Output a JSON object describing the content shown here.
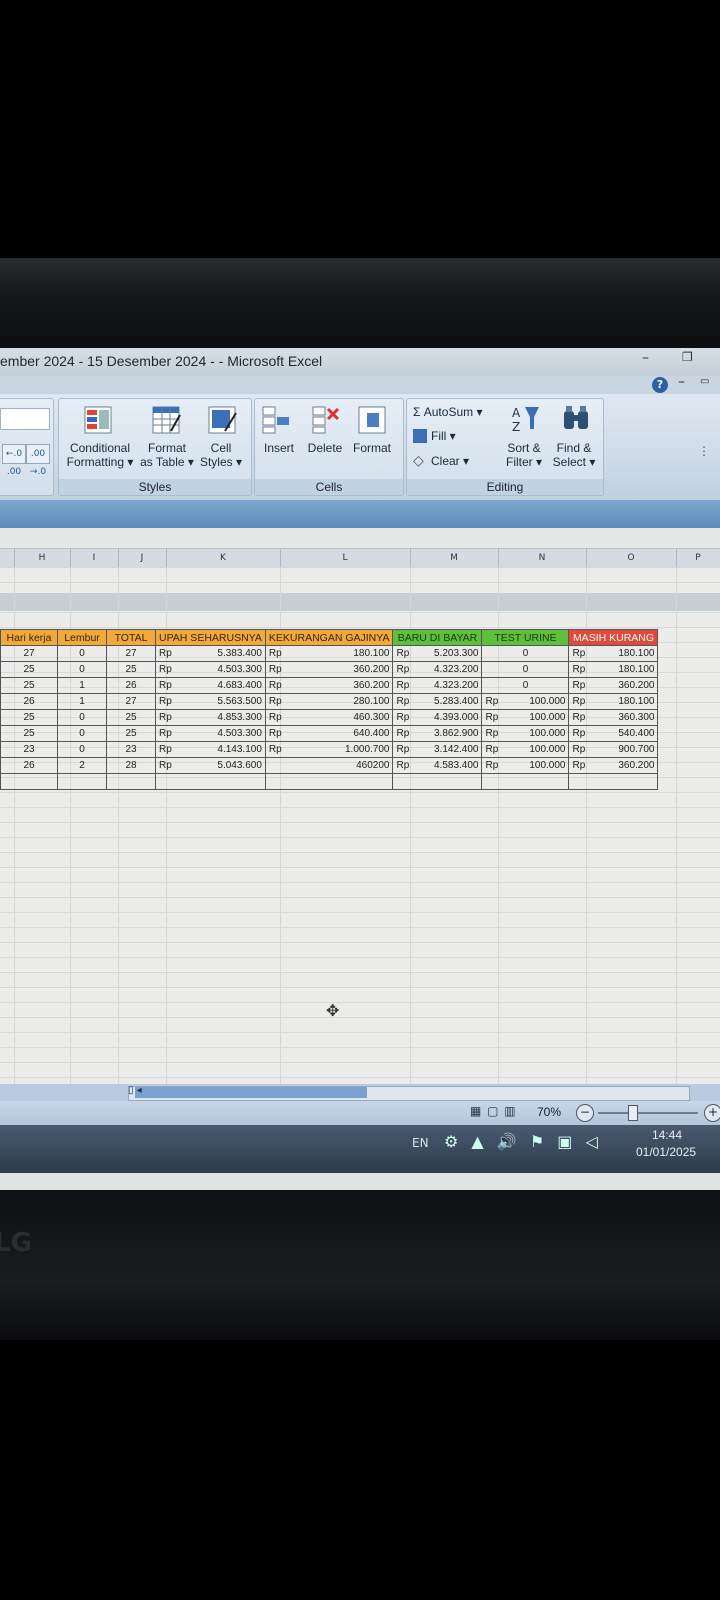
{
  "window": {
    "title": "ember 2024 - 15 Desember 2024 - - Microsoft Excel",
    "minimize": "–",
    "maximize": "❐",
    "help": "?",
    "ribbon_min": "–",
    "ribbon_restore": "▭"
  },
  "ribbon": {
    "number": {
      "inc_decimal": "←.0 .00",
      "dec_decimal": ".00 →.0"
    },
    "styles": {
      "label": "Styles",
      "conditional_formatting": "Conditional\nFormatting ▾",
      "format_as_table": "Format\nas Table ▾",
      "cell_styles": "Cell\nStyles ▾"
    },
    "cells": {
      "label": "Cells",
      "insert": "Insert",
      "delete": "Delete",
      "format": "Format"
    },
    "editing": {
      "label": "Editing",
      "autosum": "Σ AutoSum ▾",
      "fill": "Fill ▾",
      "clear": "Clear ▾",
      "sort_filter": "Sort &\nFilter ▾",
      "find_select": "Find &\nSelect ▾"
    }
  },
  "columns": [
    "H",
    "I",
    "J",
    "K",
    "L",
    "M",
    "N",
    "O",
    "P"
  ],
  "table": {
    "headers": {
      "hari_kerja": "Hari kerja",
      "lembur": "Lembur",
      "total": "TOTAL",
      "upah": "UPAH SEHARUSNYA",
      "kekurangan": "KEKURANGAN GAJINYA",
      "baru": "BARU DI BAYAR",
      "test": "TEST URINE",
      "masih": "MASIH KURANG"
    },
    "currency": "Rp",
    "rows": [
      {
        "h": "27",
        "i": "0",
        "j": "27",
        "k_rp": "Rp",
        "k": "5.383.400",
        "l_rp": "Rp",
        "l": "180.100",
        "m_rp": "Rp",
        "m": "5.203.300",
        "n_rp": "",
        "n": "0",
        "o_rp": "Rp",
        "o": "180.100"
      },
      {
        "h": "25",
        "i": "0",
        "j": "25",
        "k_rp": "Rp",
        "k": "4.503.300",
        "l_rp": "Rp",
        "l": "360.200",
        "m_rp": "Rp",
        "m": "4.323.200",
        "n_rp": "",
        "n": "0",
        "o_rp": "Rp",
        "o": "180.100"
      },
      {
        "h": "25",
        "i": "1",
        "j": "26",
        "k_rp": "Rp",
        "k": "4.683.400",
        "l_rp": "Rp",
        "l": "360.200",
        "m_rp": "Rp",
        "m": "4.323.200",
        "n_rp": "",
        "n": "0",
        "o_rp": "Rp",
        "o": "360.200"
      },
      {
        "h": "26",
        "i": "1",
        "j": "27",
        "k_rp": "Rp",
        "k": "5.563.500",
        "l_rp": "Rp",
        "l": "280.100",
        "m_rp": "Rp",
        "m": "5.283.400",
        "n_rp": "Rp",
        "n": "100.000",
        "o_rp": "Rp",
        "o": "180.100"
      },
      {
        "h": "25",
        "i": "0",
        "j": "25",
        "k_rp": "Rp",
        "k": "4.853.300",
        "l_rp": "Rp",
        "l": "460.300",
        "m_rp": "Rp",
        "m": "4.393.000",
        "n_rp": "Rp",
        "n": "100.000",
        "o_rp": "Rp",
        "o": "360.300"
      },
      {
        "h": "25",
        "i": "0",
        "j": "25",
        "k_rp": "Rp",
        "k": "4.503.300",
        "l_rp": "Rp",
        "l": "640.400",
        "m_rp": "Rp",
        "m": "3.862.900",
        "n_rp": "Rp",
        "n": "100.000",
        "o_rp": "Rp",
        "o": "540.400"
      },
      {
        "h": "23",
        "i": "0",
        "j": "23",
        "k_rp": "Rp",
        "k": "4.143.100",
        "l_rp": "Rp",
        "l": "1.000.700",
        "m_rp": "Rp",
        "m": "3.142.400",
        "n_rp": "Rp",
        "n": "100.000",
        "o_rp": "Rp",
        "o": "900.700"
      },
      {
        "h": "26",
        "i": "2",
        "j": "28",
        "k_rp": "Rp",
        "k": "5.043.600",
        "l_rp": "",
        "l": "460200",
        "m_rp": "Rp",
        "m": "4.583.400",
        "n_rp": "Rp",
        "n": "100.000",
        "o_rp": "Rp",
        "o": "360.200"
      }
    ]
  },
  "status": {
    "view_buttons": "▦ ▢ ▥",
    "zoom": "70%",
    "zoom_out": "−",
    "zoom_in": "+"
  },
  "taskbar": {
    "lang": "EN",
    "tray": "⚙ ▲ 🔊 ⚑ ▣ ◁",
    "time": "14:44",
    "date": "01/01/2025"
  },
  "monitor": {
    "brand": "LG"
  },
  "colors": {
    "orange": "#f2a93b",
    "green": "#5fbf3a",
    "red": "#e04a3b",
    "ribbon": "#d3dfeb"
  }
}
